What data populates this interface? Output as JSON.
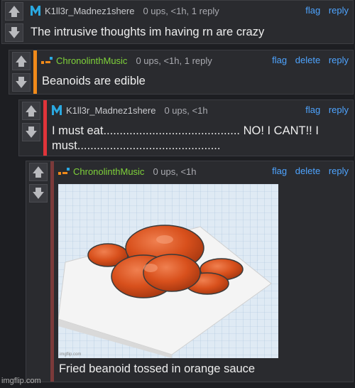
{
  "comments": [
    {
      "user": "K1ll3r_Madnez1shere",
      "meta": "0 ups, <1h, 1 reply",
      "actions": [
        "flag",
        "reply"
      ],
      "text": "The intrusive thoughts im having rn are crazy",
      "accent": "#2aa8e0"
    },
    {
      "user": "ChronolinthMusic",
      "meta": "0 ups, <1h, 1 reply",
      "actions": [
        "flag",
        "delete",
        "reply"
      ],
      "text": "Beanoids are edible",
      "accent": "#f08a1a"
    },
    {
      "user": "K1ll3r_Madnez1shere",
      "meta": "0 ups, <1h",
      "actions": [
        "flag",
        "reply"
      ],
      "text_line1": "I must eat.......................................... NO! I CANT!! I",
      "text_line2": "must............................................",
      "accent": "#e0343a"
    },
    {
      "user": "ChronolinthMusic",
      "meta": "0 ups, <1h",
      "actions": [
        "flag",
        "delete",
        "reply"
      ],
      "image_caption": "Fried beanoid tossed in orange sauce",
      "image_watermark": "imgflip.com",
      "accent": "#7a3a3a"
    }
  ],
  "icons": {
    "upvote": "arrow-up-icon",
    "downvote": "arrow-down-icon",
    "avatar_k": "k-logo-avatar",
    "avatar_c": "orange-dash-avatar"
  },
  "colors": {
    "link": "#4ea4ff",
    "background": "#1d1e22",
    "panel": "#2a2b2f",
    "bean": "#d8501c"
  },
  "watermark": "imgflip.com"
}
